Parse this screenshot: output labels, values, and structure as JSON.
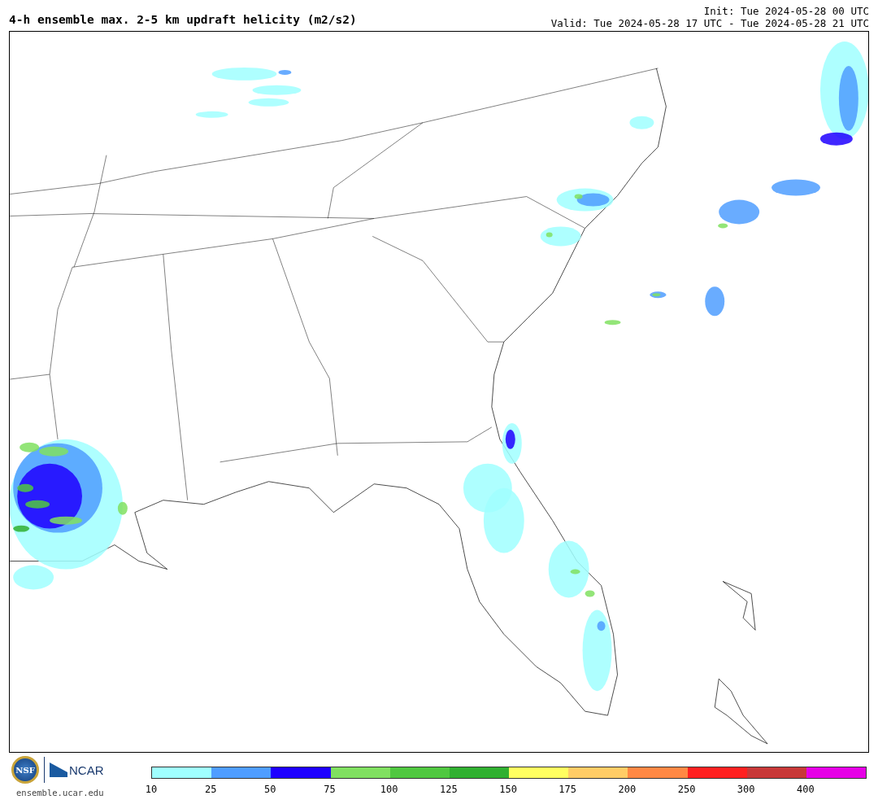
{
  "header": {
    "title": "4-h ensemble max. 2-5 km updraft helicity (m2/s2)",
    "init": "Init: Tue 2024-05-28 00 UTC",
    "valid": "Valid: Tue 2024-05-28 17 UTC - Tue 2024-05-28 21 UTC"
  },
  "footer": {
    "nsf_logo": "NSF",
    "ncar_logo": "NCAR",
    "site": "ensemble.ucar.edu"
  },
  "colorbar": {
    "segments": [
      {
        "color": "#a0ffff"
      },
      {
        "color": "#4f9dff"
      },
      {
        "color": "#1e00ff"
      },
      {
        "color": "#80e060"
      },
      {
        "color": "#50c840"
      },
      {
        "color": "#30b030"
      },
      {
        "color": "#ffff60"
      },
      {
        "color": "#ffcc66"
      },
      {
        "color": "#ff8844"
      },
      {
        "color": "#ff2020"
      },
      {
        "color": "#c83838"
      },
      {
        "color": "#e600e6"
      }
    ],
    "labels": [
      "10",
      "25",
      "50",
      "75",
      "100",
      "125",
      "150",
      "175",
      "200",
      "250",
      "300",
      "400"
    ]
  }
}
